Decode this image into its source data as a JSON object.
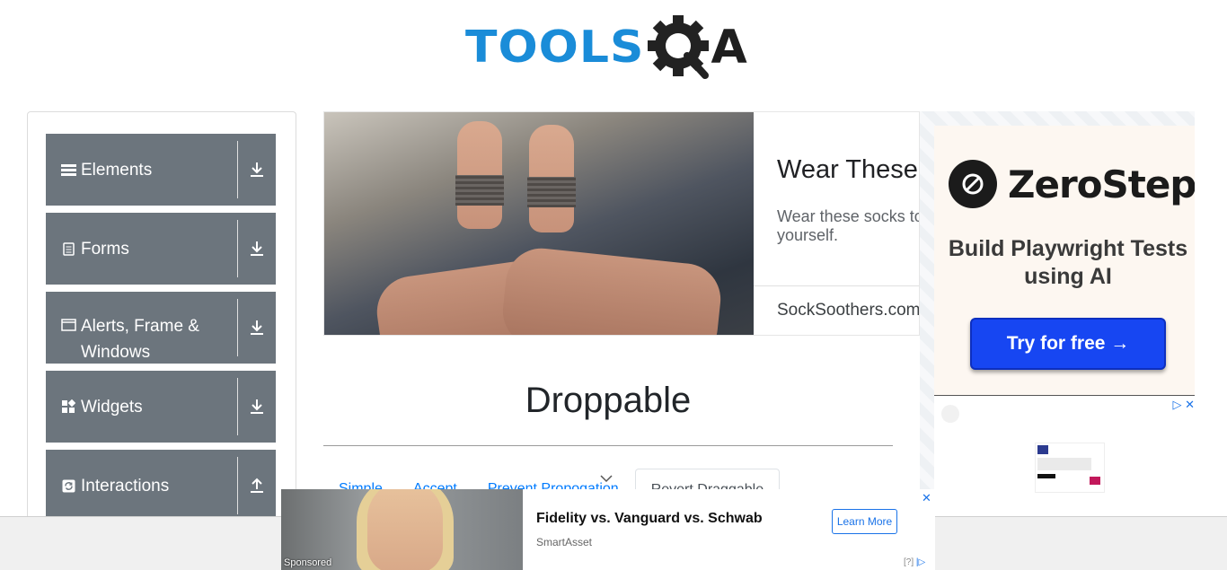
{
  "header": {
    "logo_text": "TOOLS",
    "logo_suffix": "A"
  },
  "sidebar": {
    "groups": [
      {
        "label": "Elements",
        "icon": "list-icon",
        "action_icon": "download-icon"
      },
      {
        "label": "Forms",
        "icon": "document-icon",
        "action_icon": "download-icon"
      },
      {
        "label": "Alerts, Frame & Windows",
        "icon": "window-icon",
        "action_icon": "download-icon"
      },
      {
        "label": "Widgets",
        "icon": "widgets-icon",
        "action_icon": "download-icon"
      },
      {
        "label": "Interactions",
        "icon": "refresh-icon",
        "action_icon": "upload-icon"
      }
    ]
  },
  "ad_banner": {
    "headline": "Wear These",
    "description": "Wear these socks to yourself.",
    "site": "SockSoothers.com"
  },
  "ad_right": {
    "brand": "ZeroStep",
    "tagline": "Build Playwright Tests using AI",
    "cta": "Try for free →"
  },
  "main": {
    "title": "Droppable",
    "tabs": [
      {
        "label": "Simple",
        "active": false
      },
      {
        "label": "Accept",
        "active": false
      },
      {
        "label": "Prevent Propogation",
        "active": false
      },
      {
        "label": "Revert Draggable",
        "active": true
      }
    ]
  },
  "bottom_ad": {
    "sponsored": "Sponsored",
    "title": "Fidelity vs. Vanguard vs. Schwab",
    "source": "SmartAsset",
    "cta": "Learn More",
    "info": "[?]"
  },
  "colors": {
    "sidebar_group_bg": "#6c757d",
    "link_blue": "#007bff",
    "zerostep_button": "#1746f2",
    "logo_blue": "#1a8cd8"
  }
}
